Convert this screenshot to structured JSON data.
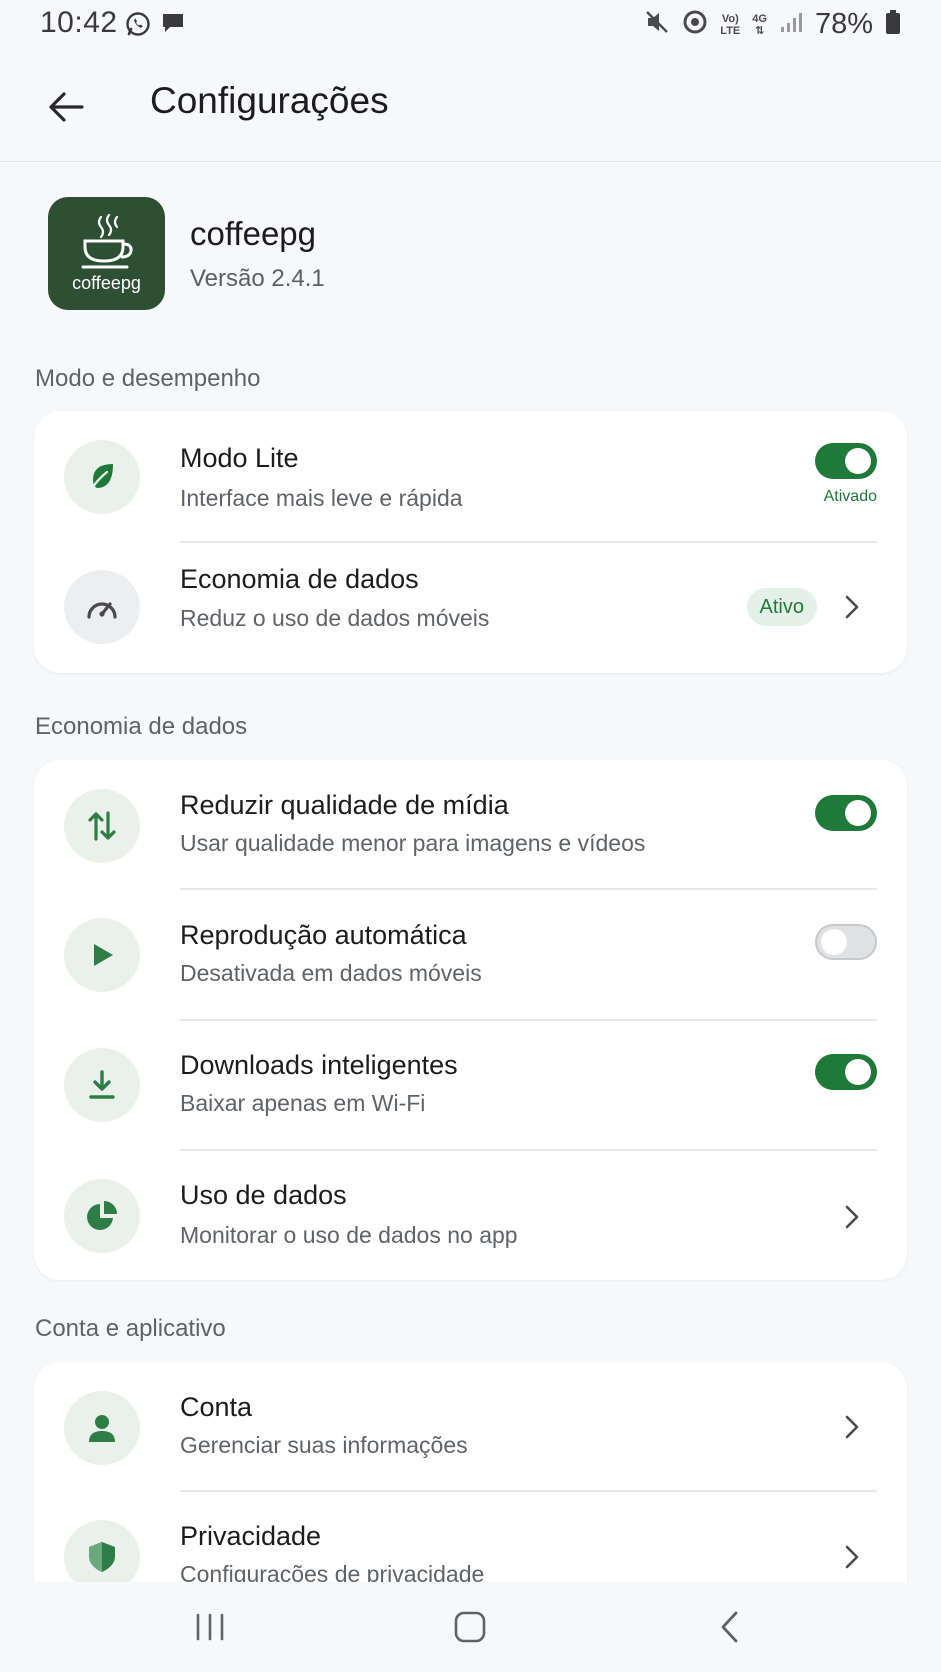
{
  "status_bar": {
    "time": "10:42",
    "battery": "78%",
    "net_top": "Vo)",
    "net_bottom": "LTE",
    "net_gen": "4G",
    "icons": [
      "whatsapp-icon",
      "message-icon",
      "mute-icon",
      "hotspot-icon",
      "volte-icon",
      "4g-icon",
      "signal-icon",
      "battery-icon"
    ]
  },
  "appbar": {
    "title": "Configurações",
    "back_icon": "arrow-left-icon"
  },
  "app_info": {
    "logo_text": "coffeepg",
    "name": "coffeepg",
    "version": "Versão 2.4.1"
  },
  "sections": {
    "performance": {
      "title": "Modo e desempenho",
      "items": [
        {
          "title": "Modo Lite",
          "subtitle": "Interface mais leve e rápida",
          "toggle": true,
          "status": "Ativado",
          "icon": "leaf-icon"
        },
        {
          "title": "Economia de dados",
          "subtitle": "Reduz o uso de dados móveis",
          "badge": "Ativo",
          "icon": "speedometer-icon"
        }
      ]
    },
    "data_saving": {
      "title": "Economia de dados",
      "items": [
        {
          "title": "Reduzir qualidade de mídia",
          "subtitle": "Usar qualidade menor para imagens e vídeos",
          "toggle": true,
          "icon": "up-down-arrows-icon"
        },
        {
          "title": "Reprodução automática",
          "subtitle": "Desativada em dados móveis",
          "toggle": false,
          "icon": "play-icon"
        },
        {
          "title": "Downloads inteligentes",
          "subtitle": "Baixar apenas em Wi-Fi",
          "toggle": true,
          "icon": "download-icon"
        },
        {
          "title": "Uso de dados",
          "subtitle": "Monitorar o uso de dados no app",
          "icon": "pie-chart-icon"
        }
      ]
    },
    "account": {
      "title": "Conta e aplicativo",
      "items": [
        {
          "title": "Conta",
          "subtitle": "Gerenciar suas informações",
          "icon": "person-icon"
        },
        {
          "title": "Privacidade",
          "subtitle": "Configurações de privacidade",
          "icon": "shield-icon"
        }
      ]
    }
  },
  "colors": {
    "accent": "#1f7a3a",
    "icon_bg": "#e9f1ea",
    "logo_bg": "#2f4f34",
    "background": "#f7f8fa"
  },
  "navbar": {
    "icons": [
      "recents-icon",
      "home-icon",
      "back-icon"
    ]
  }
}
